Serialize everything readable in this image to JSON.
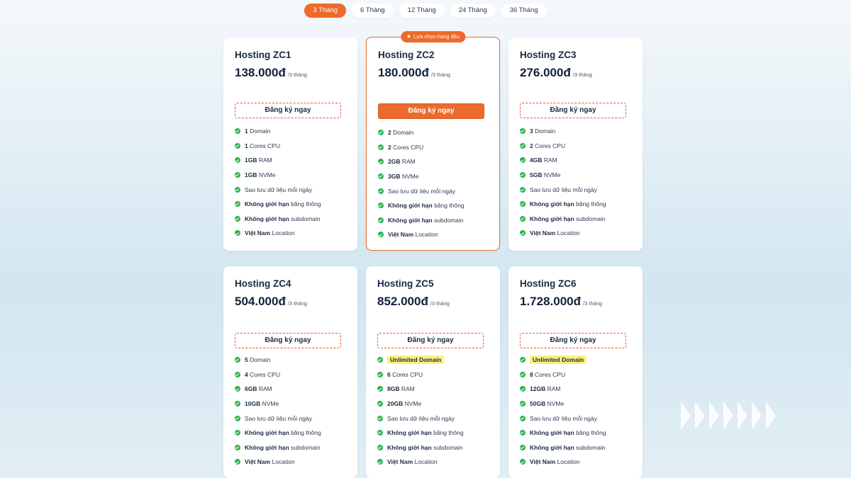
{
  "tabs": [
    {
      "label": "3 Tháng",
      "active": true
    },
    {
      "label": "6 Tháng",
      "active": false
    },
    {
      "label": "12 Tháng",
      "active": false
    },
    {
      "label": "24 Tháng",
      "active": false
    },
    {
      "label": "36 Tháng",
      "active": false
    }
  ],
  "featured_badge": "Lựa chọn hàng đầu",
  "plans": [
    {
      "name": "Hosting ZC1",
      "price": "138.000đ",
      "period": "/3 tháng",
      "button": "Đăng ký ngay",
      "features": [
        {
          "bold": "1",
          "text": " Domain"
        },
        {
          "bold": "1",
          "text": " Cores CPU"
        },
        {
          "bold": "1GB",
          "text": " RAM"
        },
        {
          "bold": "1GB",
          "text": " NVMe"
        },
        {
          "bold": "",
          "text": "Sao lưu dữ liệu mỗi ngày"
        },
        {
          "bold": "Không giới hạn",
          "text": " băng thông"
        },
        {
          "bold": "Không giới hạn",
          "text": " subdomain"
        },
        {
          "bold": "Việt Nam",
          "text": " Location"
        }
      ]
    },
    {
      "name": "Hosting ZC2",
      "price": "180.000đ",
      "period": "/3 tháng",
      "button": "Đăng ký ngay",
      "features": [
        {
          "bold": "2",
          "text": " Domain"
        },
        {
          "bold": "2",
          "text": " Cores CPU"
        },
        {
          "bold": "2GB",
          "text": " RAM"
        },
        {
          "bold": "3GB",
          "text": " NVMe"
        },
        {
          "bold": "",
          "text": "Sao lưu dữ liệu mỗi ngày"
        },
        {
          "bold": "Không giới hạn",
          "text": " băng thông"
        },
        {
          "bold": "Không giới hạn",
          "text": " subdomain"
        },
        {
          "bold": "Việt Nam",
          "text": " Location"
        }
      ]
    },
    {
      "name": "Hosting ZC3",
      "price": "276.000đ",
      "period": "/3 tháng",
      "button": "Đăng ký ngay",
      "features": [
        {
          "bold": "3",
          "text": " Domain"
        },
        {
          "bold": "2",
          "text": " Cores CPU"
        },
        {
          "bold": "4GB",
          "text": " RAM"
        },
        {
          "bold": "5GB",
          "text": " NVMe"
        },
        {
          "bold": "",
          "text": "Sao lưu dữ liệu mỗi ngày"
        },
        {
          "bold": "Không giới hạn",
          "text": " băng thông"
        },
        {
          "bold": "Không giới hạn",
          "text": " subdomain"
        },
        {
          "bold": "Việt Nam",
          "text": " Location"
        }
      ]
    },
    {
      "name": "Hosting ZC4",
      "price": "504.000đ",
      "period": "/3 tháng",
      "button": "Đăng ký ngay",
      "features": [
        {
          "bold": "5",
          "text": " Domain"
        },
        {
          "bold": "4",
          "text": " Cores CPU"
        },
        {
          "bold": "6GB",
          "text": " RAM"
        },
        {
          "bold": "10GB",
          "text": " NVMe"
        },
        {
          "bold": "",
          "text": "Sao lưu dữ liệu mỗi ngày"
        },
        {
          "bold": "Không giới hạn",
          "text": " băng thông"
        },
        {
          "bold": "Không giới hạn",
          "text": " subdomain"
        },
        {
          "bold": "Việt Nam",
          "text": " Location"
        }
      ]
    },
    {
      "name": "Hosting ZC5",
      "price": "852.000đ",
      "period": "/3 tháng",
      "button": "Đăng ký ngay",
      "features": [
        {
          "bold": "",
          "text": "",
          "highlight": "Unlimited Domain"
        },
        {
          "bold": "6",
          "text": " Cores CPU"
        },
        {
          "bold": "8GB",
          "text": " RAM"
        },
        {
          "bold": "20GB",
          "text": " NVMe"
        },
        {
          "bold": "",
          "text": "Sao lưu dữ liệu mỗi ngày"
        },
        {
          "bold": "Không giới hạn",
          "text": " băng thông"
        },
        {
          "bold": "Không giới hạn",
          "text": " subdomain"
        },
        {
          "bold": "Việt Nam",
          "text": " Location"
        }
      ]
    },
    {
      "name": "Hosting ZC6",
      "price": "1.728.000đ",
      "period": "/3 tháng",
      "button": "Đăng ký ngay",
      "features": [
        {
          "bold": "",
          "text": "",
          "highlight": "Unlimited Domain"
        },
        {
          "bold": "8",
          "text": " Cores CPU"
        },
        {
          "bold": "12GB",
          "text": " RAM"
        },
        {
          "bold": "50GB",
          "text": " NVMe"
        },
        {
          "bold": "",
          "text": "Sao lưu dữ liệu mỗi ngày"
        },
        {
          "bold": "Không giới hạn",
          "text": " băng thông"
        },
        {
          "bold": "Không giới hạn",
          "text": " subdomain"
        },
        {
          "bold": "Việt Nam",
          "text": " Location"
        }
      ]
    }
  ],
  "colors": {
    "accent": "#ec6a2c",
    "check": "#2bb24c",
    "highlight": "#fdf07a"
  },
  "icons": {
    "feature": "check-circle-icon",
    "badge": "star-icon",
    "decoration": "chevrons-right-icon"
  }
}
